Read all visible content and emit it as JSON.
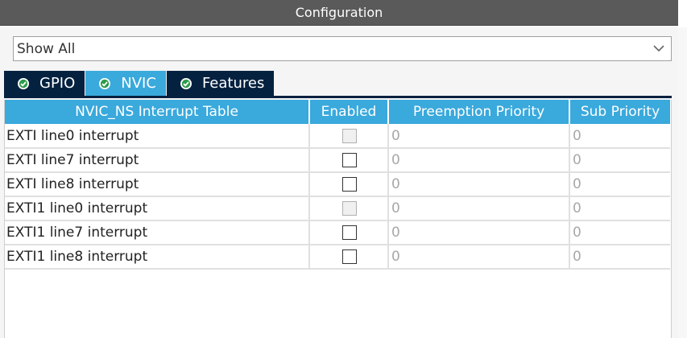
{
  "window": {
    "title": "Configuration"
  },
  "mode_select": {
    "value": "Show All"
  },
  "tabs": [
    {
      "label": "GPIO",
      "active": false,
      "icon": "check-circle-icon"
    },
    {
      "label": "NVIC",
      "active": true,
      "icon": "check-circle-icon"
    },
    {
      "label": "Features",
      "active": false,
      "icon": "check-circle-icon"
    }
  ],
  "table": {
    "headers": [
      "NVIC_NS Interrupt Table",
      "Enabled",
      "Preemption Priority",
      "Sub Priority"
    ],
    "rows": [
      {
        "name": "EXTI line0 interrupt",
        "enabled_disabled": true,
        "preemption": "0",
        "sub": "0"
      },
      {
        "name": "EXTI line7 interrupt",
        "enabled_disabled": false,
        "preemption": "0",
        "sub": "0"
      },
      {
        "name": "EXTI line8 interrupt",
        "enabled_disabled": false,
        "preemption": "0",
        "sub": "0"
      },
      {
        "name": "EXTI1 line0 interrupt",
        "enabled_disabled": true,
        "preemption": "0",
        "sub": "0"
      },
      {
        "name": "EXTI1 line7 interrupt",
        "enabled_disabled": false,
        "preemption": "0",
        "sub": "0"
      },
      {
        "name": "EXTI1 line8 interrupt",
        "enabled_disabled": false,
        "preemption": "0",
        "sub": "0"
      }
    ]
  },
  "colors": {
    "accent": "#3aa9dc",
    "tab_dark": "#04213f",
    "titlebar": "#5a5a5a"
  }
}
